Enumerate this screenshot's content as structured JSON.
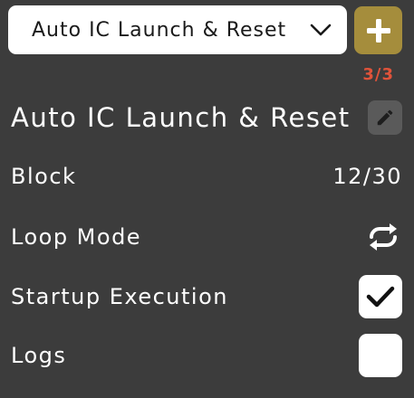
{
  "selector": {
    "value": "Auto IC Launch & Reset",
    "icon": "chevron-down-icon"
  },
  "add_button": {
    "icon": "plus-icon",
    "color": "#a58d3c"
  },
  "counter": "3/3",
  "title": "Auto IC Launch & Reset",
  "edit_icon": "pencil-icon",
  "rows": {
    "block": {
      "label": "Block",
      "value": "12/30"
    },
    "loop_mode": {
      "label": "Loop Mode",
      "icon": "loop-icon"
    },
    "startup_execution": {
      "label": "Startup Execution",
      "checked": true
    },
    "logs": {
      "label": "Logs",
      "checked": false
    }
  },
  "colors": {
    "background": "#3c3c3c",
    "accent": "#a58d3c",
    "counter": "#e0533a"
  }
}
